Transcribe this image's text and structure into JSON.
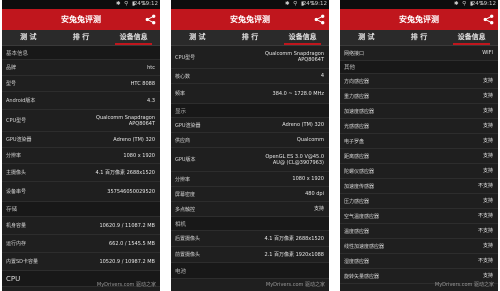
{
  "status_bar": {
    "battery": "24%",
    "time": "19:12"
  },
  "app": {
    "title": "安兔兔评测",
    "share_icon": "share-icon",
    "accent": "#c0161d"
  },
  "tabs": [
    "测 试",
    "排 行",
    "设备信息"
  ],
  "watermark": "MyDrivers.com 驱动之家",
  "panels": [
    {
      "sections": [
        {
          "title": "基本信息",
          "rows": [
            {
              "label": "品牌",
              "value": "htc"
            },
            {
              "label": "型号",
              "value": "HTC 8088"
            },
            {
              "label": "Android版本",
              "value": "4.3"
            },
            {
              "label": "CPU型号",
              "value": "Qualcomm Snapdragon APQ8064T"
            },
            {
              "label": "GPU渲染器",
              "value": "Adreno (TM) 320"
            },
            {
              "label": "分辨率",
              "value": "1080 x 1920"
            },
            {
              "label": "主摄像头",
              "value": "4.1 百万像素  2688x1520"
            },
            {
              "label": "设备串号",
              "value": "357546050029520"
            }
          ]
        },
        {
          "title": "存储",
          "rows": [
            {
              "label": "机身容量",
              "value": "10620.9 / 11087.2 MB"
            },
            {
              "label": "运行内存",
              "value": "662.0 / 1545.5 MB"
            },
            {
              "label": "内置SD卡容量",
              "value": "10520.9 / 10987.2 MB"
            }
          ]
        },
        {
          "title": "CPU",
          "rows": []
        }
      ]
    },
    {
      "sections": [
        {
          "title": "",
          "rows": [
            {
              "label": "CPU型号",
              "value": "Qualcomm Snapdragon APQ8064T"
            },
            {
              "label": "核心数",
              "value": "4"
            },
            {
              "label": "频率",
              "value": "384.0 ~ 1728.0 MHz"
            }
          ]
        },
        {
          "title": "显示",
          "rows": [
            {
              "label": "GPU渲染器",
              "value": "Adreno (TM) 320"
            },
            {
              "label": "供应商",
              "value": "Qualcomm"
            },
            {
              "label": "GPU版本",
              "value": "OpenGL ES 3.0 V@45.0 AU@ (CL@3907963)"
            },
            {
              "label": "分辨率",
              "value": "1080 x 1920"
            },
            {
              "label": "屏幕密度",
              "value": "480 dpi"
            },
            {
              "label": "多点触控",
              "value": "支持"
            }
          ]
        },
        {
          "title": "相机",
          "rows": [
            {
              "label": "后置摄像头",
              "value": "4.1 百万像素  2688x1520"
            },
            {
              "label": "前置摄像头",
              "value": "2.1 百万像素  1920x1088"
            }
          ]
        },
        {
          "title": "电池",
          "rows": []
        }
      ]
    },
    {
      "sections": [
        {
          "title": "",
          "rows": [
            {
              "label": "网络接口",
              "value": "WIFI"
            }
          ]
        },
        {
          "title": "其他",
          "rows": [
            {
              "label": "方向感应器",
              "value": "支持"
            },
            {
              "label": "重力感应器",
              "value": "支持"
            },
            {
              "label": "加速度感应器",
              "value": "支持"
            },
            {
              "label": "光感感应器",
              "value": "支持"
            },
            {
              "label": "电子罗盘",
              "value": "支持"
            },
            {
              "label": "距离感应器",
              "value": "支持"
            },
            {
              "label": "陀螺仪感应器",
              "value": "支持"
            },
            {
              "label": "加速度传感器",
              "value": "不支持"
            },
            {
              "label": "压力感应器",
              "value": "支持"
            },
            {
              "label": "空气温度感应器",
              "value": "不支持"
            },
            {
              "label": "温度感应器",
              "value": "不支持"
            },
            {
              "label": "线性加速度感应器",
              "value": "支持"
            },
            {
              "label": "湿度感应器",
              "value": "不支持"
            },
            {
              "label": "旋转矢量感应器",
              "value": "支持"
            }
          ]
        }
      ]
    }
  ]
}
